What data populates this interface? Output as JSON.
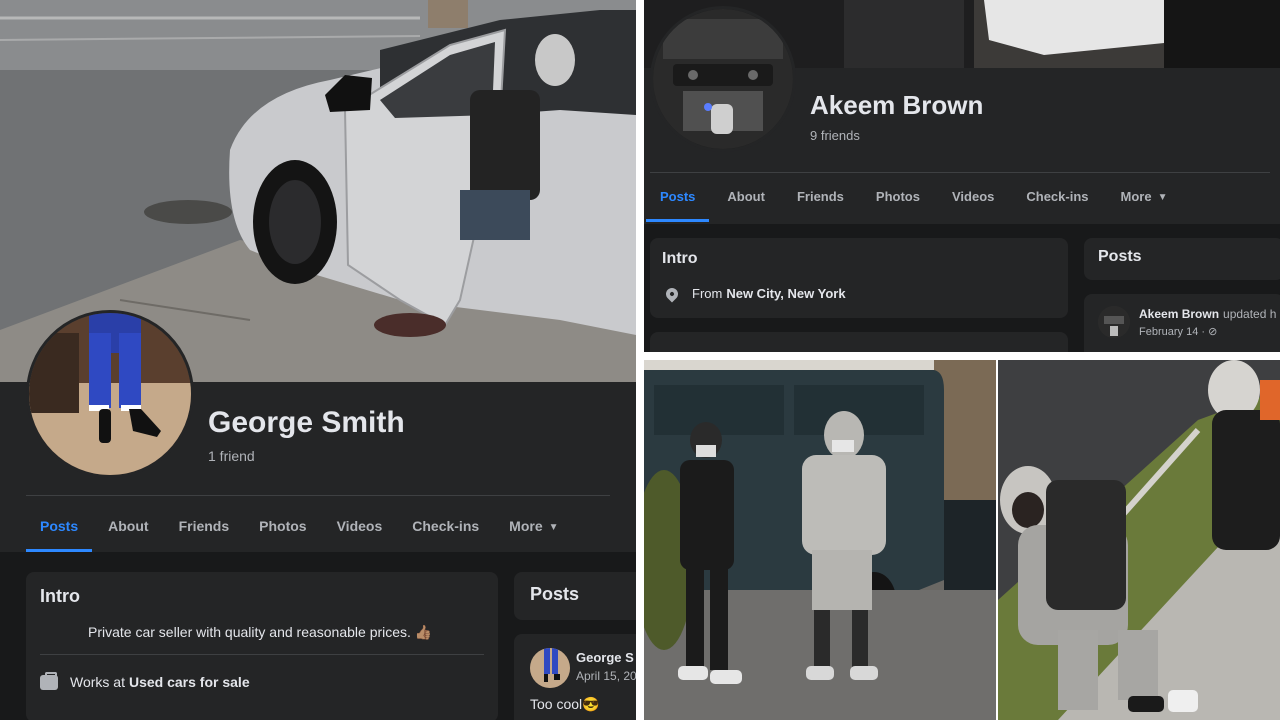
{
  "left_profile": {
    "name": "George Smith",
    "friends": "1 friend",
    "tabs": [
      "Posts",
      "About",
      "Friends",
      "Photos",
      "Videos",
      "Check-ins",
      "More"
    ],
    "active_tab": "Posts",
    "intro_title": "Intro",
    "bio": "Private car seller with quality and reasonable prices. 👍🏽",
    "work_prefix": "Works at",
    "work_place": "Used cars for sale",
    "posts_title": "Posts",
    "post_author": "George S",
    "post_date": "April 15, 20",
    "post_text": "Too cool😎"
  },
  "right_profile": {
    "name": "Akeem Brown",
    "friends": "9 friends",
    "tabs": [
      "Posts",
      "About",
      "Friends",
      "Photos",
      "Videos",
      "Check-ins",
      "More"
    ],
    "active_tab": "Posts",
    "intro_title": "Intro",
    "from_prefix": "From",
    "from_place": "New City, New York",
    "posts_title": "Posts",
    "post_author": "Akeem Brown",
    "post_action": "updated h",
    "post_date": "February 14 · ⊘"
  },
  "colors": {
    "background": "#18191a",
    "card": "#242526",
    "text_primary": "#e4e6eb",
    "text_secondary": "#b0b3b8",
    "accent": "#2d88ff"
  }
}
